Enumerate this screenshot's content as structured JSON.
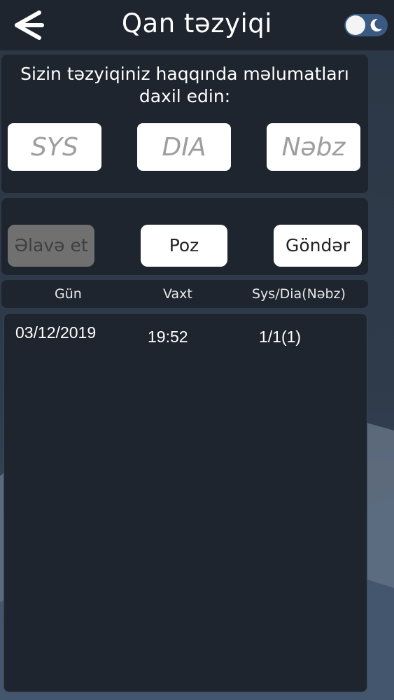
{
  "header": {
    "title": "Qan təzyiqi",
    "back_icon": "back-arrow-icon",
    "theme_toggle_icon": "moon-icon"
  },
  "input": {
    "prompt": "Sizin təzyiqiniz haqqında məlumatları daxil edin:",
    "sys_placeholder": "SYS",
    "dia_placeholder": "DIA",
    "pulse_placeholder": "Nəbz"
  },
  "actions": {
    "add_label": "Əlavə et",
    "delete_label": "Poz",
    "send_label": "Göndər"
  },
  "table": {
    "columns": [
      "Gün",
      "Vaxt",
      "Sys/Dia(Nəbz)"
    ],
    "rows": [
      {
        "date": "03/12/2019",
        "time": "19:52",
        "value": "1/1(1)"
      }
    ]
  },
  "colors": {
    "panel": "#1e252e",
    "background": "#2f3b4b",
    "disabled_button": "#707070"
  }
}
